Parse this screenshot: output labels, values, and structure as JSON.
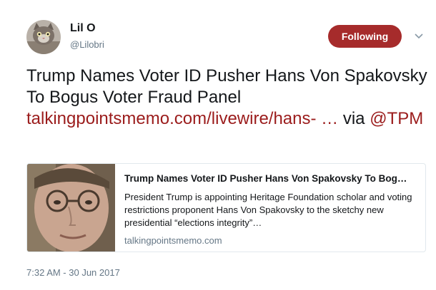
{
  "user": {
    "display_name": "Lil O",
    "screen_name": "@Lilobri",
    "avatar_icon": "cat-avatar"
  },
  "follow_button": {
    "label": "Following",
    "color": "#a62b2b"
  },
  "tweet": {
    "text_main": "Trump Names Voter ID Pusher Hans Von Spakovsky To Bogus Voter Fraud Panel ",
    "link_text": "talkingpointsmemo.com/livewire/hans-  …",
    "via_text": " via ",
    "mention": "@TPM",
    "link_color": "#9b1c1c"
  },
  "card": {
    "title": "Trump Names Voter ID Pusher Hans Von Spakovsky To Bog…",
    "description": "President Trump is appointing Heritage Foundation scholar and voting restrictions proponent Hans Von Spakovsky to the sketchy new presidential “elections integrity”…",
    "domain": "talkingpointsmemo.com",
    "image_icon": "man-with-glasses-photo"
  },
  "timestamp": "7:32 AM - 30 Jun 2017"
}
